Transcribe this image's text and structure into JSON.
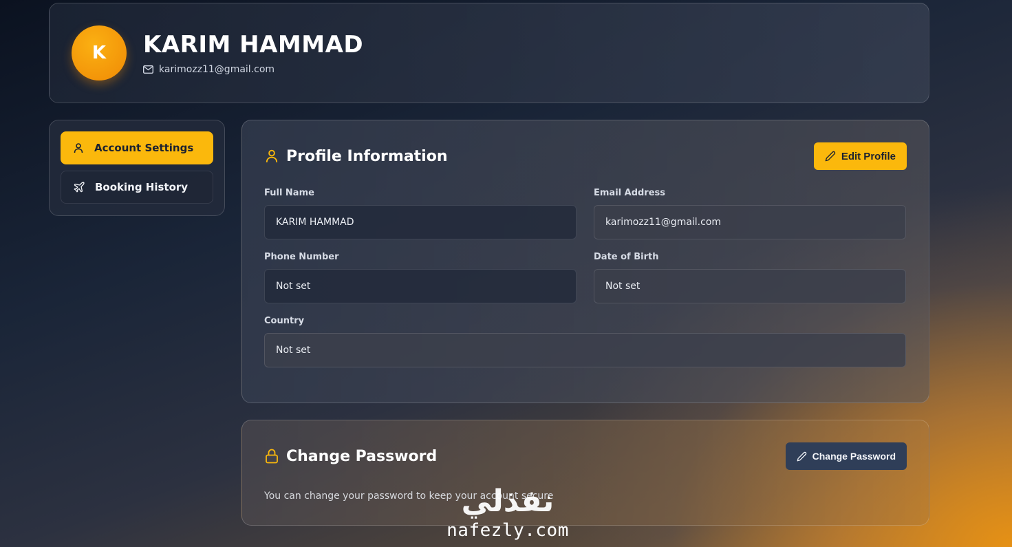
{
  "header": {
    "avatar_initial": "K",
    "name": "KARIM HAMMAD",
    "email": "karimozz11@gmail.com",
    "email_icon": "mail-icon"
  },
  "sidebar": {
    "items": [
      {
        "label": "Account Settings",
        "icon": "user-icon",
        "active": true
      },
      {
        "label": "Booking History",
        "icon": "plane-icon",
        "active": false
      }
    ]
  },
  "profile": {
    "title": "Profile Information",
    "icon": "user-icon",
    "edit_button": "Edit Profile",
    "fields": {
      "full_name": {
        "label": "Full Name",
        "value": "KARIM HAMMAD"
      },
      "email": {
        "label": "Email Address",
        "value": "karimozz11@gmail.com"
      },
      "phone": {
        "label": "Phone Number",
        "value": "Not set"
      },
      "dob": {
        "label": "Date of Birth",
        "value": "Not set"
      },
      "country": {
        "label": "Country",
        "value": "Not set"
      }
    }
  },
  "password": {
    "title": "Change Password",
    "icon": "lock-icon",
    "button": "Change Password",
    "description": "You can change your password to keep your account secure"
  },
  "watermark": {
    "arabic": "نفذلي",
    "latin": "nafezly.com"
  },
  "colors": {
    "accent": "#fbb80c",
    "avatar": "#f5a00a",
    "navy_button": "#2f3e58"
  }
}
